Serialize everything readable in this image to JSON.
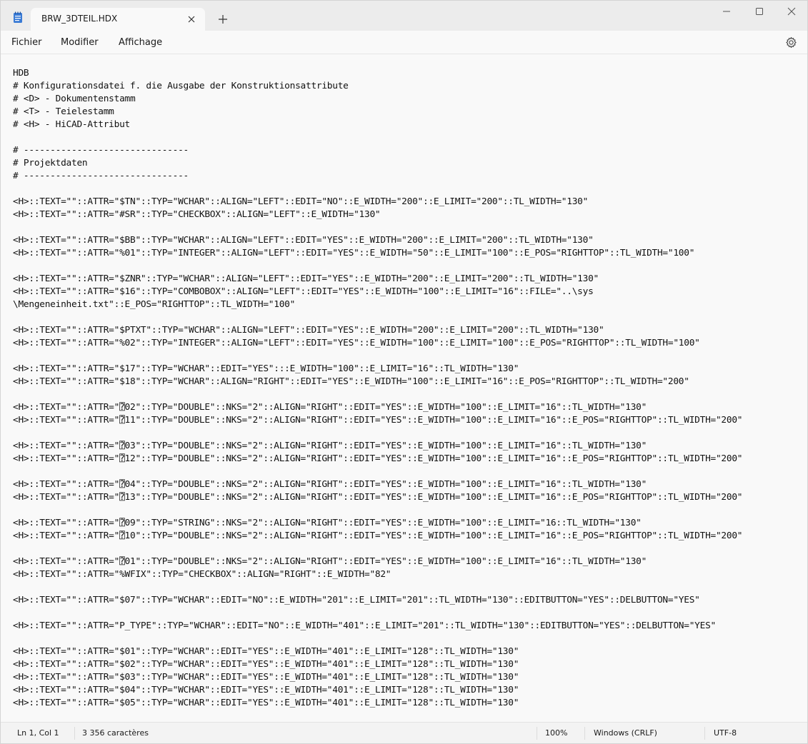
{
  "window": {
    "tab_title": "BRW_3DTEIL.HDX"
  },
  "menu": {
    "file": "Fichier",
    "edit": "Modifier",
    "view": "Affichage"
  },
  "editor": {
    "lines": [
      "HDB",
      "# Konfigurationsdatei f. die Ausgabe der Konstruktionsattribute",
      "# <D> - Dokumentenstamm",
      "# <T> - Teielestamm",
      "# <H> - HiCAD-Attribut",
      "",
      "# -------------------------------",
      "# Projektdaten",
      "# -------------------------------",
      "",
      "<H>::TEXT=\"\"::ATTR=\"$TN\"::TYP=\"WCHAR\"::ALIGN=\"LEFT\"::EDIT=\"NO\"::E_WIDTH=\"200\"::E_LIMIT=\"200\"::TL_WIDTH=\"130\"",
      "<H>::TEXT=\"\"::ATTR=\"#SR\"::TYP=\"CHECKBOX\"::ALIGN=\"LEFT\"::E_WIDTH=\"130\"",
      "",
      "<H>::TEXT=\"\"::ATTR=\"$BB\"::TYP=\"WCHAR\"::ALIGN=\"LEFT\"::EDIT=\"YES\"::E_WIDTH=\"200\"::E_LIMIT=\"200\"::TL_WIDTH=\"130\"",
      "<H>::TEXT=\"\"::ATTR=\"%01\"::TYP=\"INTEGER\"::ALIGN=\"LEFT\"::EDIT=\"YES\"::E_WIDTH=\"50\"::E_LIMIT=\"100\"::E_POS=\"RIGHTTOP\"::TL_WIDTH=\"100\"",
      "",
      "<H>::TEXT=\"\"::ATTR=\"$ZNR\"::TYP=\"WCHAR\"::ALIGN=\"LEFT\"::EDIT=\"YES\"::E_WIDTH=\"200\"::E_LIMIT=\"200\"::TL_WIDTH=\"130\"",
      "<H>::TEXT=\"\"::ATTR=\"$16\"::TYP=\"COMBOBOX\"::ALIGN=\"LEFT\"::EDIT=\"YES\"::E_WIDTH=\"100\"::E_LIMIT=\"16\"::FILE=\"..\\sys",
      "\\Mengeneinheit.txt\"::E_POS=\"RIGHTTOP\"::TL_WIDTH=\"100\"",
      "",
      "<H>::TEXT=\"\"::ATTR=\"$PTXT\"::TYP=\"WCHAR\"::ALIGN=\"LEFT\"::EDIT=\"YES\"::E_WIDTH=\"200\"::E_LIMIT=\"200\"::TL_WIDTH=\"130\"",
      "<H>::TEXT=\"\"::ATTR=\"%02\"::TYP=\"INTEGER\"::ALIGN=\"LEFT\"::EDIT=\"YES\"::E_WIDTH=\"100\"::E_LIMIT=\"100\"::E_POS=\"RIGHTTOP\"::TL_WIDTH=\"100\"",
      "",
      "<H>::TEXT=\"\"::ATTR=\"$17\"::TYP=\"WCHAR\"::EDIT=\"YES\":::E_WIDTH=\"100\"::E_LIMIT=\"16\"::TL_WIDTH=\"130\"",
      "<H>::TEXT=\"\"::ATTR=\"$18\"::TYP=\"WCHAR\"::ALIGN=\"RIGHT\"::EDIT=\"YES\"::E_WIDTH=\"100\"::E_LIMIT=\"16\"::E_POS=\"RIGHTTOP\"::TL_WIDTH=\"200\"",
      "",
      "<H>::TEXT=\"\"::ATTR=\"⍰02\"::TYP=\"DOUBLE\"::NKS=\"2\"::ALIGN=\"RIGHT\"::EDIT=\"YES\"::E_WIDTH=\"100\"::E_LIMIT=\"16\"::TL_WIDTH=\"130\"",
      "<H>::TEXT=\"\"::ATTR=\"⍰11\"::TYP=\"DOUBLE\"::NKS=\"2\"::ALIGN=\"RIGHT\"::EDIT=\"YES\"::E_WIDTH=\"100\"::E_LIMIT=\"16\"::E_POS=\"RIGHTTOP\"::TL_WIDTH=\"200\"",
      "",
      "<H>::TEXT=\"\"::ATTR=\"⍰03\"::TYP=\"DOUBLE\"::NKS=\"2\"::ALIGN=\"RIGHT\"::EDIT=\"YES\"::E_WIDTH=\"100\"::E_LIMIT=\"16\"::TL_WIDTH=\"130\"",
      "<H>::TEXT=\"\"::ATTR=\"⍰12\"::TYP=\"DOUBLE\"::NKS=\"2\"::ALIGN=\"RIGHT\"::EDIT=\"YES\"::E_WIDTH=\"100\"::E_LIMIT=\"16\"::E_POS=\"RIGHTTOP\"::TL_WIDTH=\"200\"",
      "",
      "<H>::TEXT=\"\"::ATTR=\"⍰04\"::TYP=\"DOUBLE\"::NKS=\"2\"::ALIGN=\"RIGHT\"::EDIT=\"YES\"::E_WIDTH=\"100\"::E_LIMIT=\"16\"::TL_WIDTH=\"130\"",
      "<H>::TEXT=\"\"::ATTR=\"⍰13\"::TYP=\"DOUBLE\"::NKS=\"2\"::ALIGN=\"RIGHT\"::EDIT=\"YES\"::E_WIDTH=\"100\"::E_LIMIT=\"16\"::E_POS=\"RIGHTTOP\"::TL_WIDTH=\"200\"",
      "",
      "<H>::TEXT=\"\"::ATTR=\"⍰09\"::TYP=\"STRING\"::NKS=\"2\"::ALIGN=\"RIGHT\"::EDIT=\"YES\"::E_WIDTH=\"100\"::E_LIMIT=\"16::TL_WIDTH=\"130\"",
      "<H>::TEXT=\"\"::ATTR=\"⍰10\"::TYP=\"DOUBLE\"::NKS=\"2\"::ALIGN=\"RIGHT\"::EDIT=\"YES\"::E_WIDTH=\"100\"::E_LIMIT=\"16\"::E_POS=\"RIGHTTOP\"::TL_WIDTH=\"200\"",
      "",
      "<H>::TEXT=\"\"::ATTR=\"⍰01\"::TYP=\"DOUBLE\"::NKS=\"2\"::ALIGN=\"RIGHT\"::EDIT=\"YES\"::E_WIDTH=\"100\"::E_LIMIT=\"16\"::TL_WIDTH=\"130\"",
      "<H>::TEXT=\"\"::ATTR=\"%WFIX\"::TYP=\"CHECKBOX\"::ALIGN=\"RIGHT\"::E_WIDTH=\"82\"",
      "",
      "<H>::TEXT=\"\"::ATTR=\"$07\"::TYP=\"WCHAR\"::EDIT=\"NO\"::E_WIDTH=\"201\"::E_LIMIT=\"201\"::TL_WIDTH=\"130\"::EDITBUTTON=\"YES\"::DELBUTTON=\"YES\"",
      "",
      "<H>::TEXT=\"\"::ATTR=\"P_TYPE\"::TYP=\"WCHAR\"::EDIT=\"NO\"::E_WIDTH=\"401\"::E_LIMIT=\"201\"::TL_WIDTH=\"130\"::EDITBUTTON=\"YES\"::DELBUTTON=\"YES\"",
      "",
      "<H>::TEXT=\"\"::ATTR=\"$01\"::TYP=\"WCHAR\"::EDIT=\"YES\"::E_WIDTH=\"401\"::E_LIMIT=\"128\"::TL_WIDTH=\"130\"",
      "<H>::TEXT=\"\"::ATTR=\"$02\"::TYP=\"WCHAR\"::EDIT=\"YES\"::E_WIDTH=\"401\"::E_LIMIT=\"128\"::TL_WIDTH=\"130\"",
      "<H>::TEXT=\"\"::ATTR=\"$03\"::TYP=\"WCHAR\"::EDIT=\"YES\"::E_WIDTH=\"401\"::E_LIMIT=\"128\"::TL_WIDTH=\"130\"",
      "<H>::TEXT=\"\"::ATTR=\"$04\"::TYP=\"WCHAR\"::EDIT=\"YES\"::E_WIDTH=\"401\"::E_LIMIT=\"128\"::TL_WIDTH=\"130\"",
      "<H>::TEXT=\"\"::ATTR=\"$05\"::TYP=\"WCHAR\"::EDIT=\"YES\"::E_WIDTH=\"401\"::E_LIMIT=\"128\"::TL_WIDTH=\"130\""
    ]
  },
  "status": {
    "position": "Ln 1, Col 1",
    "chars": "3 356 caractères",
    "zoom": "100%",
    "line_ending": "Windows (CRLF)",
    "encoding": "UTF-8"
  },
  "icons": {
    "app": "notepad-icon",
    "tab_close": "close-icon",
    "new_tab": "plus-icon",
    "minimize": "minimize-icon",
    "maximize": "maximize-icon",
    "close": "close-icon",
    "settings": "gear-icon"
  },
  "colors": {
    "app_icon": "#3a7bd5"
  }
}
